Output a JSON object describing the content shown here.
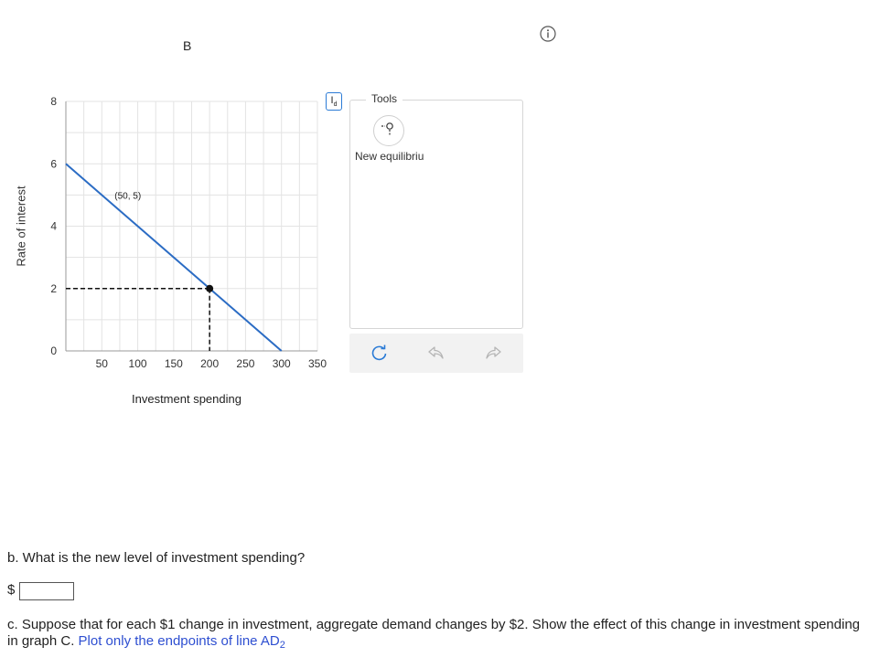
{
  "graph": {
    "title": "B",
    "y_axis_label": "Rate of interest",
    "x_axis_label": "Investment spending",
    "curve_label_main": "I",
    "curve_label_sub": "d",
    "point_label": "(50, 5)"
  },
  "chart_data": {
    "type": "line",
    "title": "B",
    "xlabel": "Investment spending",
    "ylabel": "Rate of interest",
    "xlim": [
      0,
      350
    ],
    "ylim": [
      0,
      8
    ],
    "x_ticks": [
      50,
      100,
      150,
      200,
      250,
      300,
      350
    ],
    "y_ticks": [
      0,
      2,
      4,
      6,
      8
    ],
    "grid": true,
    "series": [
      {
        "name": "Id",
        "x": [
          0,
          300
        ],
        "y": [
          6,
          0
        ],
        "color": "#2b6cc4"
      }
    ],
    "equilibrium_point": {
      "x": 200,
      "y": 2
    },
    "annotations": [
      {
        "text": "(50, 5)",
        "x": 50,
        "y": 5
      }
    ]
  },
  "tools": {
    "title": "Tools",
    "point_tool_label": "New equilibriu",
    "point_tool_icon": "point-tool-icon",
    "reset_icon": "reset-icon",
    "undo_icon": "undo-icon",
    "redo_icon": "redo-icon"
  },
  "info_icon": "info-icon",
  "question_b": {
    "text": "b. What is the new level of investment spending?",
    "currency_symbol": "$",
    "answer_value": ""
  },
  "question_c": {
    "text": "c. Suppose that for each $1 change in investment, aggregate demand changes by $2. Show the effect of this change in investment spending in graph C.",
    "highlight_text": "Plot only the endpoints of line AD",
    "highlight_sub": "2"
  },
  "colors": {
    "line": "#2b6cc4",
    "accent": "#2b7bd6",
    "link": "#2e4fd1",
    "grid": "#e3e3e3"
  }
}
